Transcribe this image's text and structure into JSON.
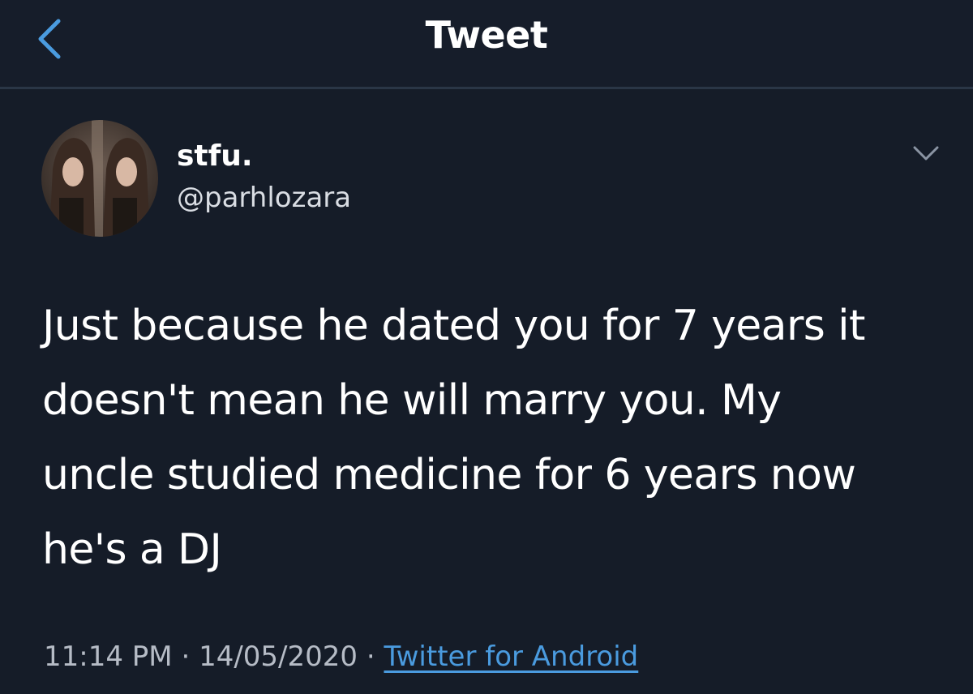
{
  "header": {
    "title": "Tweet",
    "back_icon": "chevron-left-icon"
  },
  "tweet": {
    "display_name": "stfu.",
    "handle": "@parhlozara",
    "more_icon": "chevron-down-icon",
    "text_lines": [
      "Just because he dated you for 7 years it",
      "doesn't mean he will marry you. My",
      "uncle studied medicine for 6 years now",
      "he's a DJ"
    ],
    "time": "11:14 PM",
    "separator": "·",
    "date": "14/05/2020",
    "source": "Twitter for Android"
  },
  "colors": {
    "background": "#151c28",
    "accent": "#4a9bdf",
    "secondary_text": "#b6bcc6"
  }
}
